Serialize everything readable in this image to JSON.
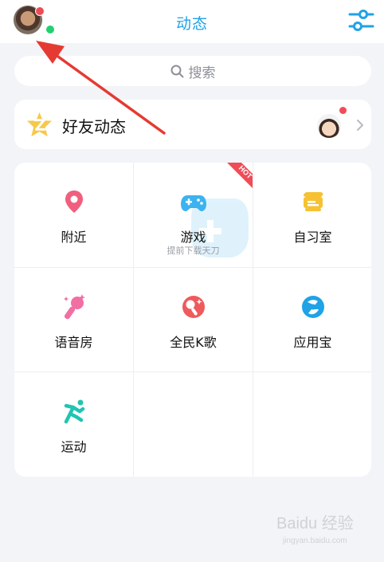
{
  "header": {
    "title": "动态"
  },
  "search": {
    "placeholder": "搜索"
  },
  "friends": {
    "label": "好友动态"
  },
  "grid": {
    "items": [
      {
        "label": "附近",
        "icon": "location-pin-icon"
      },
      {
        "label": "游戏",
        "icon": "gamepad-icon",
        "badge": "HOT",
        "sublabel": "提前下载天刀"
      },
      {
        "label": "自习室",
        "icon": "study-room-icon"
      },
      {
        "label": "语音房",
        "icon": "microphone-icon"
      },
      {
        "label": "全民K歌",
        "icon": "karaoke-icon"
      },
      {
        "label": "应用宝",
        "icon": "app-store-icon"
      },
      {
        "label": "运动",
        "icon": "running-icon"
      }
    ]
  },
  "watermark": {
    "brand": "Baidu 经验",
    "url": "jingyan.baidu.com"
  },
  "colors": {
    "accent": "#20a2e6",
    "background": "#f3f4f8",
    "hot_badge": "#f04c58",
    "arrow": "#e53a32"
  }
}
